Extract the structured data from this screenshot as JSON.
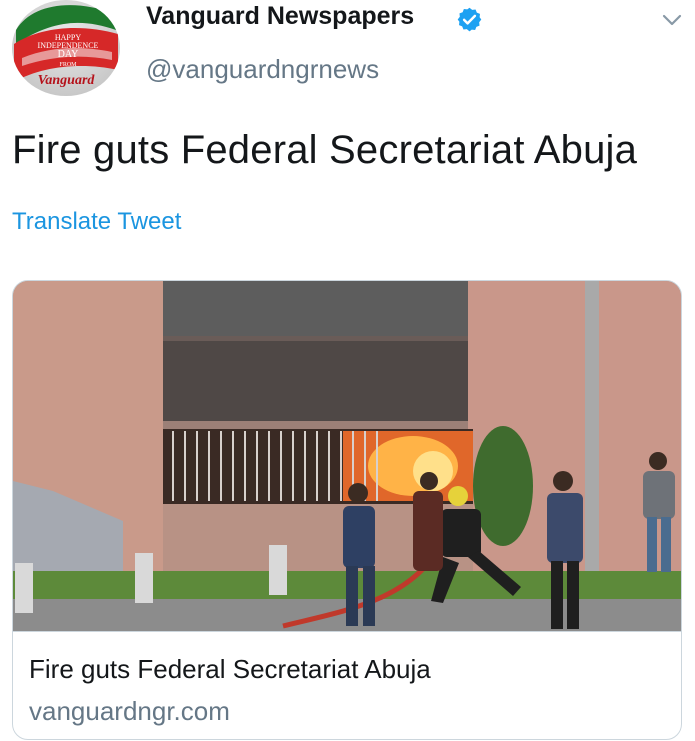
{
  "tweet": {
    "author_name": "Vanguard Newspapers",
    "author_handle": "@vanguardngrnews",
    "text": "Fire guts Federal Secretariat Abuja",
    "translate_label": "Translate Tweet"
  },
  "avatar": {
    "banner_line1": "HAPPY",
    "banner_line2": "INDEPENDENCE",
    "banner_line3": "DAY",
    "banner_line4": "FROM",
    "logo_text": "Vanguard"
  },
  "card": {
    "title": "Fire guts Federal Secretariat Abuja",
    "domain": "vanguardngr.com"
  },
  "colors": {
    "link": "#1b95e0",
    "secondary_text": "#657786",
    "verified": "#1da1f2",
    "primary_text": "#14171a"
  },
  "icons": {
    "verified": "verified-badge-icon",
    "chevron": "chevron-down-icon"
  }
}
